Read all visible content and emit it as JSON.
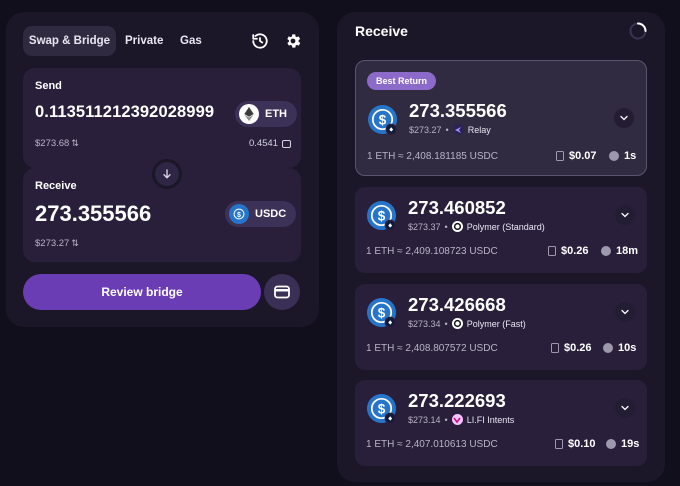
{
  "tabs": {
    "swap_bridge": "Swap & Bridge",
    "private": "Private",
    "gas": "Gas"
  },
  "header_icons": [
    "history-icon",
    "gear-icon"
  ],
  "send": {
    "label": "Send",
    "amount": "0.113511212392028999",
    "fiat": "$273.68",
    "token": "ETH",
    "balance": "0.4541"
  },
  "receive": {
    "label": "Receive",
    "amount": "273.355566",
    "fiat": "$273.27",
    "token": "USDC"
  },
  "review_button": "Review bridge",
  "receive_panel": {
    "title": "Receive",
    "routes": [
      {
        "badge": "Best Return",
        "amount": "273.355566",
        "fiat": "$273.27",
        "provider": "Relay",
        "rate": "1 ETH ≈ 2,408.181185 USDC",
        "fee": "$0.07",
        "time": "1s"
      },
      {
        "amount": "273.460852",
        "fiat": "$273.37",
        "provider": "Polymer (Standard)",
        "rate": "1 ETH ≈ 2,409.108723 USDC",
        "fee": "$0.26",
        "time": "18m"
      },
      {
        "amount": "273.426668",
        "fiat": "$273.34",
        "provider": "Polymer (Fast)",
        "rate": "1 ETH ≈ 2,408.807572 USDC",
        "fee": "$0.26",
        "time": "10s"
      },
      {
        "amount": "273.222693",
        "fiat": "$273.14",
        "provider": "LI.FI Intents",
        "rate": "1 ETH ≈ 2,407.010613 USDC",
        "fee": "$0.10",
        "time": "19s"
      }
    ]
  },
  "colors": {
    "background": "#120f1c",
    "panel": "#1c1629",
    "box": "#291f3b",
    "accent": "#6a3db4",
    "badge": "#8b6ac9",
    "usdc": "#2775ca"
  }
}
